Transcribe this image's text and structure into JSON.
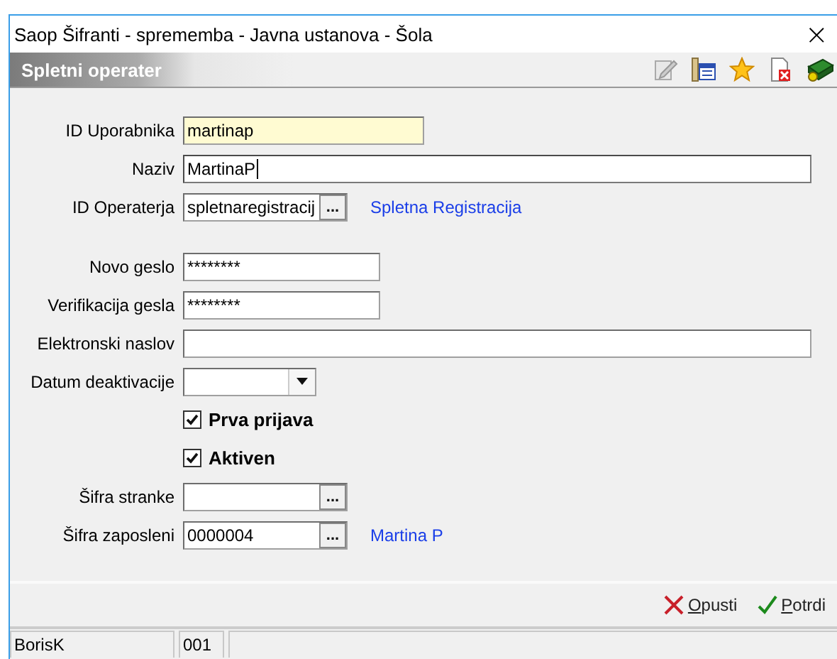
{
  "window": {
    "title": "Saop Šifranti - sprememba - Javna ustanova - Šola",
    "close": "×"
  },
  "header": {
    "title": "Spletni operater"
  },
  "fields": [
    {
      "kind": "text",
      "label": "ID Uporabnika",
      "value": "martinap",
      "highlighted": true,
      "focused": false
    },
    {
      "kind": "text",
      "label": "Naziv",
      "value": "MartinaP",
      "highlighted": false,
      "focused": true
    },
    {
      "kind": "lookup",
      "label": "ID Operaterja",
      "value": "spletnaregistracij",
      "button": "...",
      "link": "Spletna Registracija",
      "highlighted": false,
      "focused": false
    },
    {
      "kind": "spacer"
    },
    {
      "kind": "text",
      "label": "Novo geslo",
      "value": "********",
      "highlighted": false,
      "focused": false
    },
    {
      "kind": "text",
      "label": "Verifikacija gesla",
      "value": "********",
      "highlighted": false,
      "focused": false
    },
    {
      "kind": "text",
      "label": "Elektronski naslov",
      "highlighted": false,
      "focused": false
    },
    {
      "kind": "dropdown",
      "label": "Datum deaktivacije",
      "highlighted": false
    },
    {
      "kind": "checkbox",
      "label": "Prva prijava",
      "checked": true
    },
    {
      "kind": "checkbox",
      "label": "Aktiven",
      "checked": true
    },
    {
      "kind": "lookup",
      "label": "Šifra stranke",
      "button": "...",
      "highlighted": false,
      "focused": false
    },
    {
      "kind": "lookup",
      "label": "Šifra zaposleni",
      "value": "0000004",
      "button": "...",
      "link": "Martina  P",
      "highlighted": false,
      "focused": false
    }
  ],
  "buttons": [
    {
      "kind": "cancel",
      "label": "Opusti"
    },
    {
      "kind": "confirm",
      "label": "Potrdi"
    }
  ],
  "status_bar": [
    "BorisK",
    "001"
  ]
}
